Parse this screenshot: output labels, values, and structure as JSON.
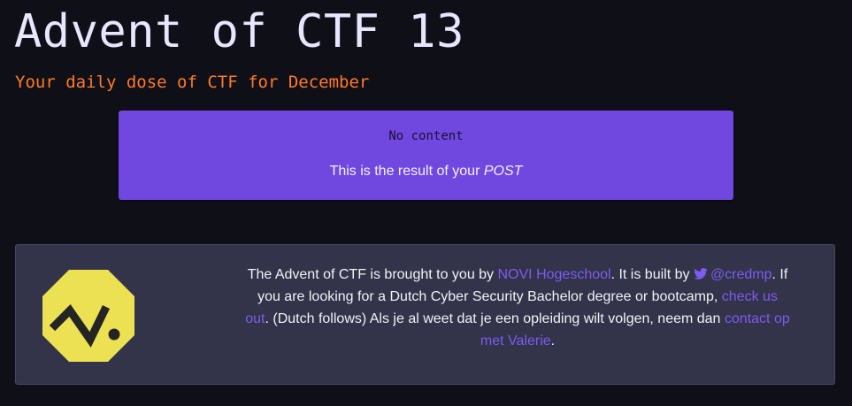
{
  "header": {
    "title": "Advent of CTF 13",
    "subtitle": "Your daily dose of CTF for December"
  },
  "result": {
    "status": "No content",
    "message_prefix": "This is the result of your ",
    "method": "POST"
  },
  "footer": {
    "text_1": "The Advent of CTF is brought to you by ",
    "link_novi": "NOVI Hogeschool",
    "text_2": ". It is built by ",
    "link_twitter": "@credmp",
    "text_3": ". If you are looking for a Dutch Cyber Security Bachelor degree or bootcamp, ",
    "link_check": "check us out",
    "text_4": ". (Dutch follows) Als je al weet dat je een opleiding wilt volgen, neem dan ",
    "link_contact": "contact op met Valerie",
    "text_5": "."
  },
  "colors": {
    "background": "#0f0f17",
    "accent_purple": "#7048e0",
    "subtitle_orange": "#ff7a28",
    "logo_yellow": "#ece053",
    "link": "#7c5cf0"
  }
}
